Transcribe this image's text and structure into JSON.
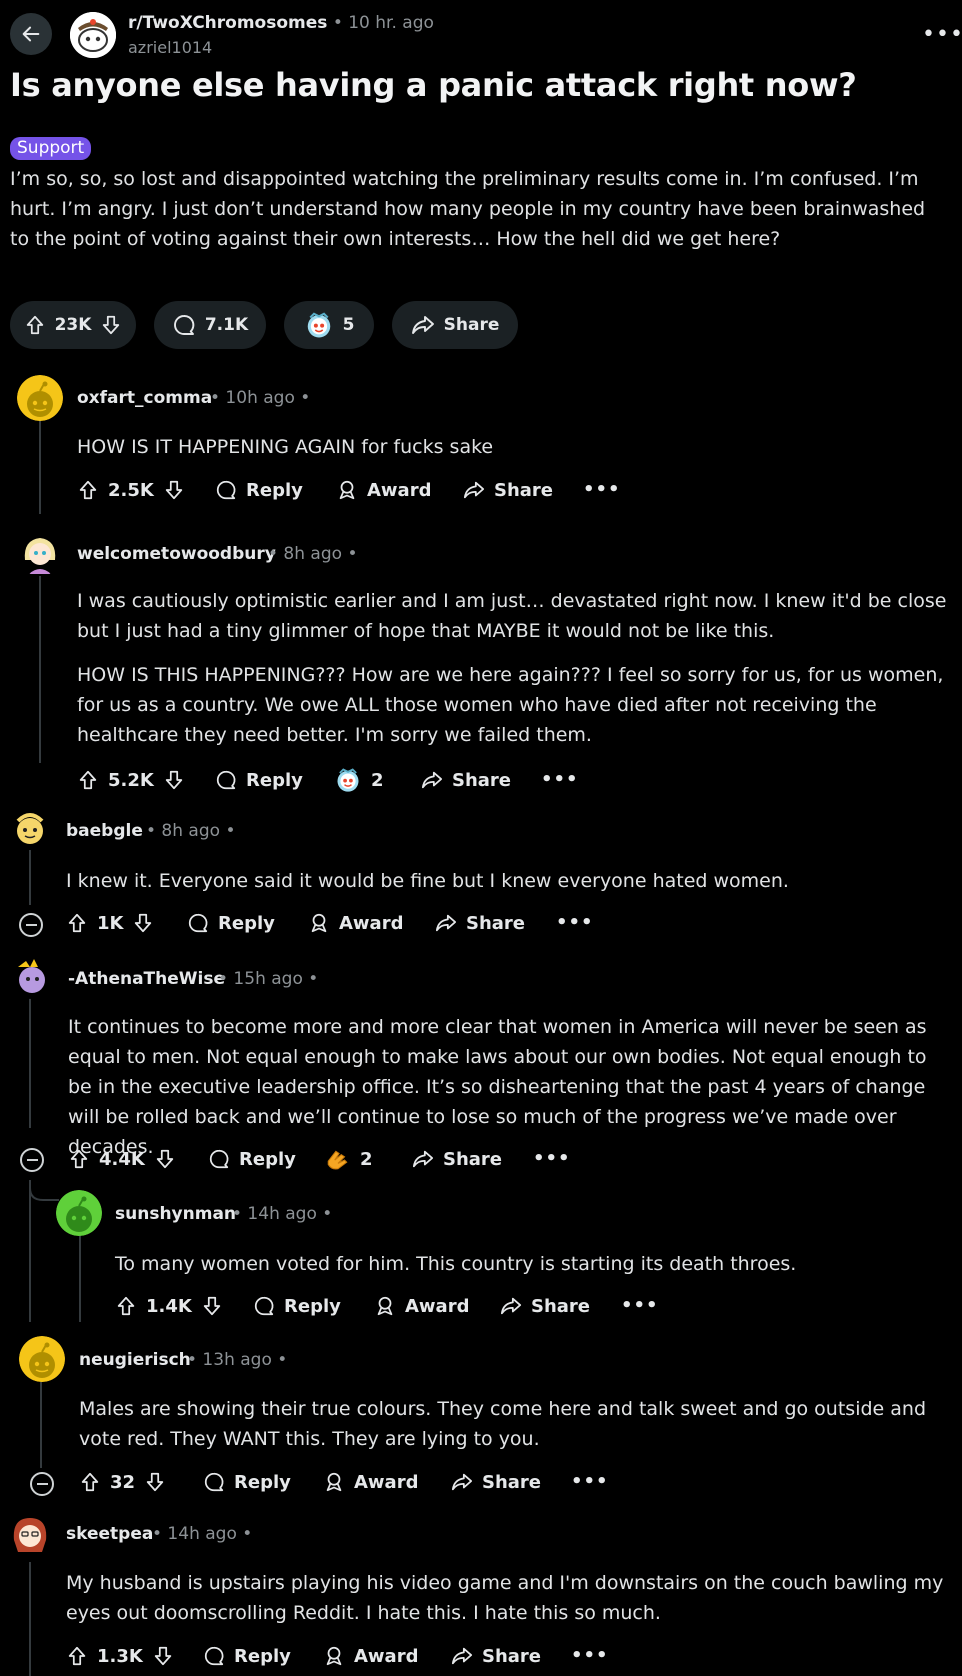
{
  "header": {
    "subreddit": "r/TwoXChromosomes",
    "time": "• 10 hr. ago",
    "author": "azriel1014",
    "more": "•••"
  },
  "post": {
    "title": "Is anyone else having a panic attack right now?",
    "flair": "Support",
    "body": "I’m so, so, so lost and disappointed watching the preliminary results come in. I’m confused. I’m hurt. I’m angry. I just don’t understand how many people in my country have been brainwashed to the point of voting against their own interests… How the hell did we get here?",
    "votes": "23K",
    "comments": "7.1K",
    "awards": "5",
    "share": "Share"
  },
  "labels": {
    "reply": "Reply",
    "award": "Award",
    "share": "Share",
    "more": "•••"
  },
  "comments": [
    {
      "user": "oxfart_comma",
      "time": "• 10h ago •",
      "paragraphs": [
        "HOW IS IT HAPPENING AGAIN for fucks sake"
      ],
      "votes": "2.5K"
    },
    {
      "user": "welcometowoodbury",
      "time": "• 8h ago •",
      "paragraphs": [
        "I was cautiously optimistic earlier and I am just… devastated right now. I knew it'd be close but I just had a tiny glimmer of hope that MAYBE it would not be like this.",
        "HOW IS THIS HAPPENING??? How are we here again??? I feel so sorry for us, for us women, for us as a country. We owe ALL those women who have died after not receiving the healthcare they need better. I'm sorry we failed them."
      ],
      "votes": "5.2K",
      "award_count": "2"
    },
    {
      "user": "baebgle",
      "time": "• 8h ago •",
      "paragraphs": [
        "I knew it. Everyone said it would be fine but I knew everyone hated women."
      ],
      "votes": "1K"
    },
    {
      "user": "-AthenaTheWise",
      "time": "• 15h ago •",
      "paragraphs": [
        "It continues to become more and more clear that women in America will never be seen as equal to men. Not equal enough to make laws about our own bodies. Not equal enough to be in the executive leadership office. It’s so disheartening that the past 4 years of change will be rolled back and we’ll continue to lose so much of the progress we’ve made over decades."
      ],
      "votes": "4.4K",
      "award_count": "2"
    },
    {
      "user": "sunshynman",
      "time": "• 14h ago •",
      "paragraphs": [
        "To many women voted for him. This country is starting its death throes."
      ],
      "votes": "1.4K"
    },
    {
      "user": "neugierisch",
      "time": "• 13h ago •",
      "paragraphs": [
        "Males are showing their true colours. They come here and talk sweet and go outside and vote red. They WANT this. They are lying to you."
      ],
      "votes": "32"
    },
    {
      "user": "skeetpea",
      "time": "• 14h ago •",
      "paragraphs": [
        "My husband is upstairs playing his video game and I'm downstairs on the couch bawling my eyes out doomscrolling Reddit. I hate this. I hate this so much."
      ],
      "votes": "1.3K"
    }
  ],
  "colors": {
    "background": "#000000",
    "pill": "#1b2124",
    "flair": "#7553e8",
    "text": "#e6e8ea",
    "muted": "#8d9296",
    "snoo_yellow": "#f5c518",
    "snoo_green": "#5fd03a"
  }
}
